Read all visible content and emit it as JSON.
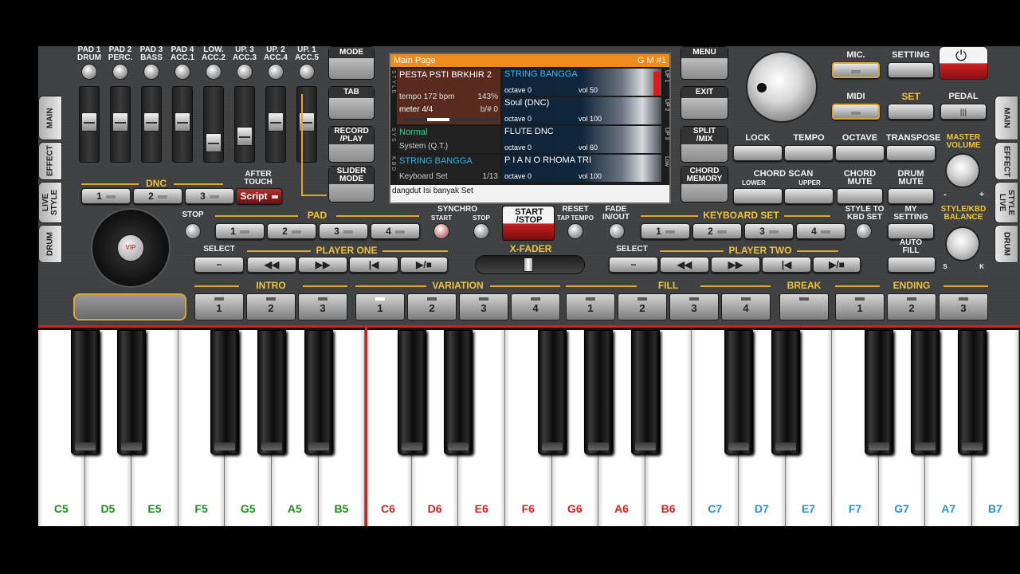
{
  "pads": {
    "labels": [
      "PAD 1\nDRUM",
      "PAD 2\nPERC.",
      "PAD 3\nBASS",
      "PAD 4\nACC.1",
      "LOW.\nACC.2",
      "UP. 3\nACC.3",
      "UP. 2\nACC.4",
      "UP. 1\nACC.5"
    ]
  },
  "left_tabs": [
    "MAIN",
    "EFFECT",
    "LIVE STYLE",
    "DRUM"
  ],
  "right_tabs": [
    "MAIN",
    "EFFECT",
    "LIVE STYLE",
    "DRUM"
  ],
  "dnc": {
    "title": "DNC",
    "buttons": [
      "1",
      "2",
      "3"
    ],
    "after_touch": "AFTER\nTOUCH",
    "script": "Script"
  },
  "mode_buttons": {
    "mode": "MODE",
    "tab": "TAB",
    "record": "RECORD\n/PLAY",
    "slider": "SLIDER\nMODE"
  },
  "lcd": {
    "header": "Main Page",
    "gm": "G M #1",
    "style_name": "PESTA PSTI BRKHIR 2",
    "tempo": "tempo 172 bpm",
    "tempo_pct": "143%",
    "meter": "meter 4/4",
    "key": "b/# 0",
    "sys_mode": "Normal",
    "sys_sub": "System (Q.T.)",
    "kbd_name": "STRING BANGGA",
    "kbd_sub": "Keyboard Set",
    "kbd_idx": "1/13",
    "footer": "dangdut Isi banyak  Set",
    "side_style": "S T Y L E",
    "side_sys": "S Y S",
    "side_kbd": "K B D",
    "parts": [
      {
        "name": "STRING BANGGA",
        "octave": "octave  0",
        "vol": "vol 50",
        "tag": "UP 1"
      },
      {
        "name": "Soul (DNC)",
        "octave": "octave  0",
        "vol": "vol 100",
        "tag": "UP 2"
      },
      {
        "name": "FLUTE DNC",
        "octave": "octave  0",
        "vol": "vol 60",
        "tag": "UP 3"
      },
      {
        "name": "P I A N O  RHOMA TRI",
        "octave": "octave  0",
        "vol": "vol 100",
        "tag": "Low"
      }
    ]
  },
  "right_mode": {
    "menu": "MENU",
    "exit": "EXIT",
    "split": "SPLIT\n/MIX",
    "chord": "CHORD\nMEMORY"
  },
  "top_right": {
    "mic": "MIC.",
    "setting": "SETTING",
    "midi": "MIDI",
    "set": "SET",
    "pedal": "PEDAL"
  },
  "row2": {
    "lock": "LOCK",
    "tempo": "TEMPO",
    "octave": "OCTAVE",
    "transpose": "TRANSPOSE",
    "master": "MASTER\nVOLUME"
  },
  "row3": {
    "chord_scan": "CHORD SCAN",
    "lower": "LOWER",
    "upper": "UPPER",
    "chord_mute": "CHORD\nMUTE",
    "drum_mute": "DRUM\nMUTE",
    "balance": "STYLE/KBD\nBALANCE",
    "bal_s": "S",
    "bal_k": "K"
  },
  "transport": {
    "stop": "STOP",
    "pad": "PAD",
    "pad_buttons": [
      "1",
      "2",
      "3",
      "4"
    ],
    "synchro": "SYNCHRO",
    "sync_start": "START",
    "sync_stop": "STOP",
    "start_stop": "START\n/STOP",
    "reset": "RESET",
    "tap": "TAP TEMPO",
    "fade": "FADE\nIN/OUT",
    "kbd_set": "KEYBOARD SET",
    "kbd_buttons": [
      "1",
      "2",
      "3",
      "4"
    ],
    "style_to": "STYLE TO\nKBD SET",
    "my_setting": "MY\nSETTING",
    "auto_fill": "AUTO\nFILL"
  },
  "players": {
    "select": "SELECT",
    "one": "PLAYER ONE",
    "two": "PLAYER TWO",
    "xfader": "X-FADER"
  },
  "sections": {
    "intro": {
      "title": "INTRO",
      "buttons": [
        "1",
        "2",
        "3"
      ]
    },
    "variation": {
      "title": "VARIATION",
      "buttons": [
        "1",
        "2",
        "3",
        "4"
      ]
    },
    "fill": {
      "title": "FILL",
      "buttons": [
        "1",
        "2",
        "3",
        "4"
      ]
    },
    "break": {
      "title": "BREAK"
    },
    "ending": {
      "title": "ENDING",
      "buttons": [
        "1",
        "2",
        "3"
      ]
    }
  },
  "volume_range": {
    "min": "-",
    "max": "+"
  },
  "keyboard": {
    "white_keys": [
      {
        "note": "C5",
        "color": "#1f8c1f"
      },
      {
        "note": "D5",
        "color": "#1f8c1f"
      },
      {
        "note": "E5",
        "color": "#1f8c1f"
      },
      {
        "note": "F5",
        "color": "#1f8c1f"
      },
      {
        "note": "G5",
        "color": "#1f8c1f"
      },
      {
        "note": "A5",
        "color": "#1f8c1f"
      },
      {
        "note": "B5",
        "color": "#1f8c1f"
      },
      {
        "note": "C6",
        "color": "#d62020"
      },
      {
        "note": "D6",
        "color": "#d62020"
      },
      {
        "note": "E6",
        "color": "#d62020"
      },
      {
        "note": "F6",
        "color": "#d62020"
      },
      {
        "note": "G6",
        "color": "#d62020"
      },
      {
        "note": "A6",
        "color": "#d62020"
      },
      {
        "note": "B6",
        "color": "#d62020"
      },
      {
        "note": "C7",
        "color": "#2a8fd6"
      },
      {
        "note": "D7",
        "color": "#2a8fd6"
      },
      {
        "note": "E7",
        "color": "#2a8fd6"
      },
      {
        "note": "F7",
        "color": "#2a8fd6"
      },
      {
        "note": "G7",
        "color": "#2a8fd6"
      },
      {
        "note": "A7",
        "color": "#2a8fd6"
      },
      {
        "note": "B7",
        "color": "#2a8fd6"
      }
    ]
  }
}
